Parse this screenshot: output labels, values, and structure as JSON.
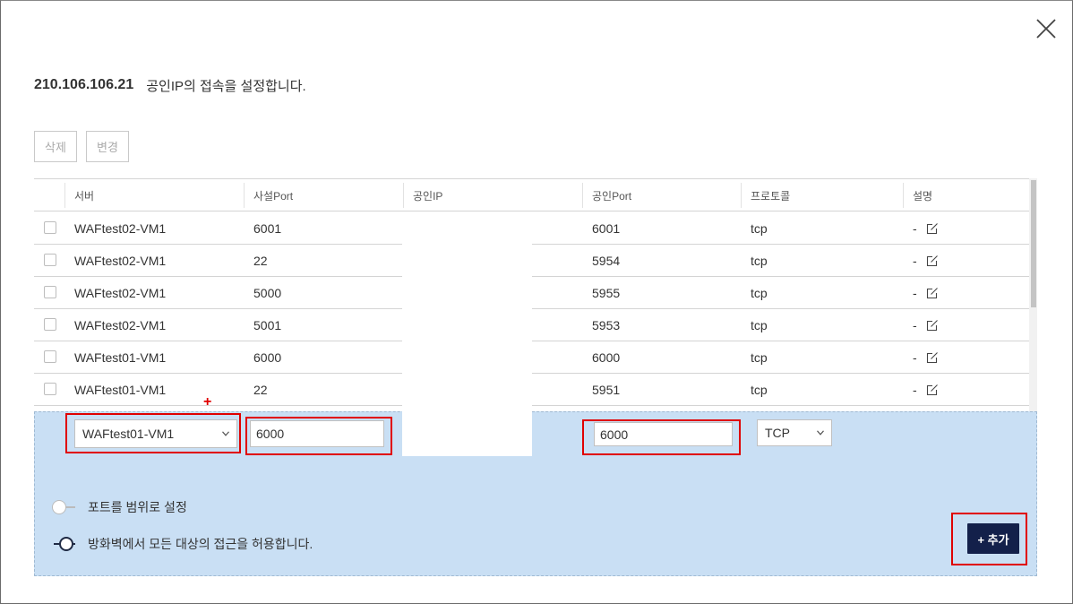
{
  "header": {
    "ip": "210.106.106.21",
    "description": "공인IP의 접속을 설정합니다."
  },
  "toolbar": {
    "delete_label": "삭제",
    "change_label": "변경"
  },
  "table": {
    "columns": [
      "서버",
      "사설Port",
      "공인IP",
      "공인Port",
      "프로토콜",
      "설명"
    ],
    "rows": [
      {
        "server": "WAFtest02-VM1",
        "private_port": "6001",
        "public_ip": "",
        "public_port": "6001",
        "protocol": "tcp",
        "description": "-"
      },
      {
        "server": "WAFtest02-VM1",
        "private_port": "22",
        "public_ip": "",
        "public_port": "5954",
        "protocol": "tcp",
        "description": "-"
      },
      {
        "server": "WAFtest02-VM1",
        "private_port": "5000",
        "public_ip": "",
        "public_port": "5955",
        "protocol": "tcp",
        "description": "-"
      },
      {
        "server": "WAFtest02-VM1",
        "private_port": "5001",
        "public_ip": "",
        "public_port": "5953",
        "protocol": "tcp",
        "description": "-"
      },
      {
        "server": "WAFtest01-VM1",
        "private_port": "6000",
        "public_ip": "",
        "public_port": "6000",
        "protocol": "tcp",
        "description": "-"
      },
      {
        "server": "WAFtest01-VM1",
        "private_port": "22",
        "public_ip": "",
        "public_port": "5951",
        "protocol": "tcp",
        "description": "-"
      }
    ]
  },
  "add_form": {
    "plus_mark": "+",
    "server_select": "WAFtest01-VM1",
    "private_port_value": "6000",
    "public_port_value": "6000",
    "protocol_select": "TCP",
    "range_toggle_label": "포트를 범위로 설정",
    "firewall_toggle_label": "방화벽에서 모든 대상의 접근을 허용합니다.",
    "add_button_label": "+ 추가"
  },
  "colors": {
    "panel": "#c9dff4",
    "primary": "#13204a",
    "highlight": "#e00000"
  },
  "icons": [
    "close-icon",
    "edit-icon",
    "chevron-down-icon"
  ]
}
